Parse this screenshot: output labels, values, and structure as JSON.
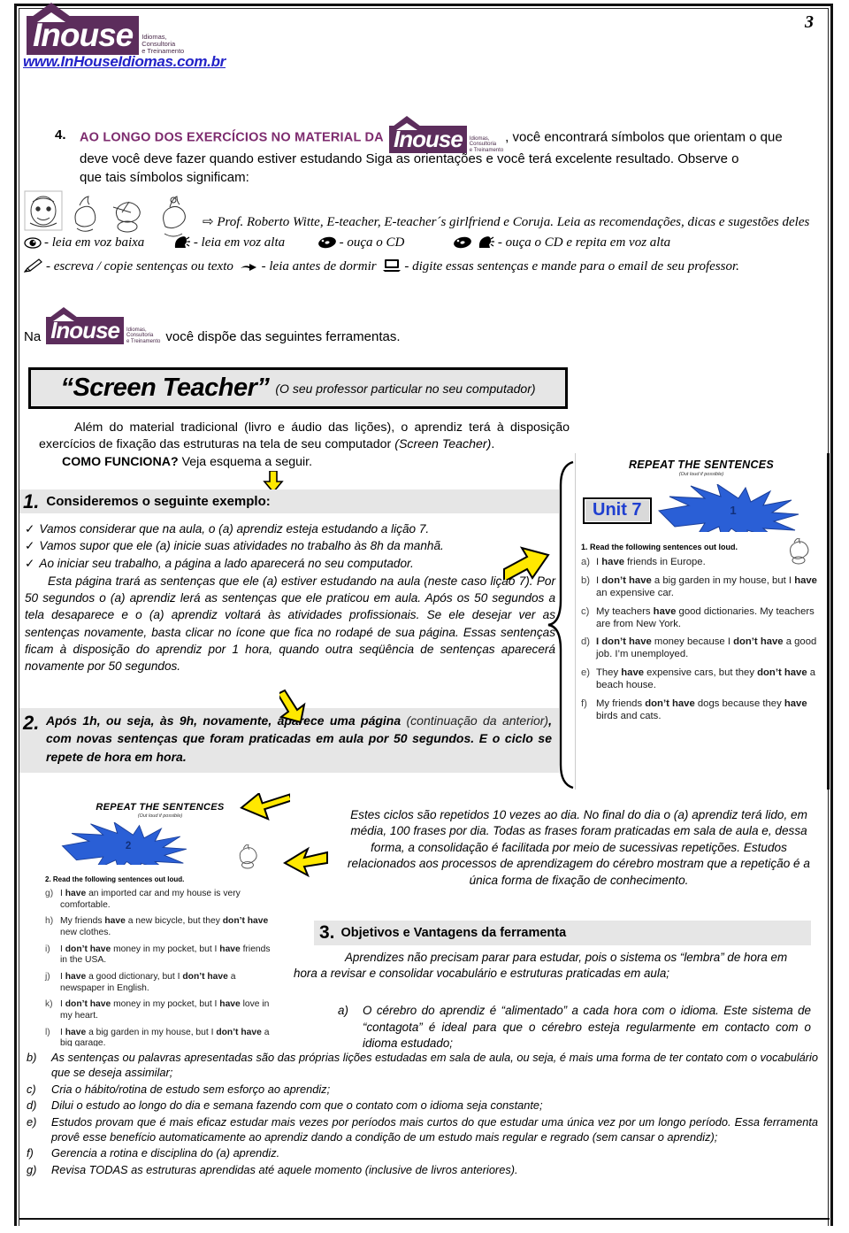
{
  "header": {
    "logo": {
      "wordmark": "nouse",
      "lead_letter": "I",
      "tagline_line1": "Idiomas,",
      "tagline_line2": "Consultoria",
      "tagline_line3": "e Treinamento",
      "brand_color": "#5c2d5c"
    },
    "url": "www.InHouseIdiomas.com.br",
    "page_number": "3"
  },
  "section4": {
    "number": "4.",
    "title": "AO LONGO DOS EXERCÍCIOS NO MATERIAL DA",
    "text_after_logo": ", você encontrará símbolos que orientam o que",
    "line2": "deve você deve fazer quando estiver estudando  Siga as orientações e você terá excelente resultado. Observe o",
    "line3": "que tais símbolos significam:"
  },
  "legend": {
    "characters_line": "Prof. Roberto Witte, E-teacher, E-teacher´s girlfriend e Coruja. Leia  as recomendações, dicas e sugestões deles",
    "arrow_glyph": "⇨",
    "items": [
      {
        "icon": "eye-icon",
        "glyph": "👁",
        "label": "- leia em voz baixa"
      },
      {
        "icon": "speaking-head-icon",
        "glyph": "🗣",
        "label": "- leia em voz alta"
      },
      {
        "icon": "cd-icon",
        "glyph": "💿",
        "label": "- ouça o CD"
      },
      {
        "icon": "cd-and-speaking-head-icon",
        "glyph": "💿🗣",
        "label": "- ouça o CD e repita em voz alta"
      },
      {
        "icon": "pencil-icon",
        "glyph": "✎",
        "label": "- escreva / copie sentenças ou texto"
      },
      {
        "icon": "bed-reading-icon",
        "glyph": "🛏",
        "label": "- leia antes de dormir"
      },
      {
        "icon": "computer-icon",
        "glyph": "🖥",
        "label": "- digite essas sentenças e mande para o email de seu professor."
      }
    ]
  },
  "tools_line": {
    "prefix": "Na",
    "suffix": "você dispõe das seguintes ferramentas."
  },
  "screen_teacher": {
    "title": "“Screen Teacher”",
    "subtitle": "(O seu professor particular no seu computador)",
    "paragraph_indent": "Além do material tradicional (livro e áudio das lições), o aprendiz terá à disposição exercícios de fixação das estruturas na tela de seu computador ",
    "paragraph_italic": "(Screen Teacher)",
    "paragraph_end": ".",
    "how_label": "COMO FUNCIONA?",
    "how_text": " Veja esquema a seguir."
  },
  "block1": {
    "number": "1.",
    "heading": "Consideremos o seguinte exemplo:",
    "bullets": [
      "Vamos considerar que na aula, o (a) aprendiz esteja estudando a lição 7.",
      "Vamos supor que ele (a) inicie suas atividades no trabalho às 8h da manhã.",
      "Ao iniciar seu trabalho, a página a lado aparecerá no seu computador."
    ],
    "paragraph": "Esta página trará as sentenças que ele (a) estiver estudando na aula (neste caso lição 7). Por 50 segundos o (a) aprendiz lerá as sentenças que ele praticou em aula. Após os 50 segundos a tela desaparece e o (a) aprendiz voltará às atividades profissionais. Se ele desejar ver as sentenças novamente, basta clicar no ícone que fica no rodapé de sua página. Essas sentenças ficam à disposição do aprendiz por 1 hora, quando outra seqüência de sentenças aparecerá novamente por 50 segundos."
  },
  "block2": {
    "number": "2.",
    "part1": "Após 1h, ou seja, às 9h, novamente, aparece uma página ",
    "part2_light": "(continuação da anterior)",
    "part3": ", com novas sentenças que foram praticadas em aula por 50 segundos. E o ciclo se repete de hora em hora."
  },
  "screenshot_unit7": {
    "title": "REPEAT THE SENTENCES",
    "subtitle": "(Out loud if possible)",
    "unit_label": "Unit 7",
    "star_number": "1",
    "instruction": "1. Read the following sentences out loud.",
    "sentences": [
      {
        "letter": "a)",
        "html": "I <b>have</b> friends in Europe."
      },
      {
        "letter": "b)",
        "html": "I <b>don’t have</b> a big garden in my house, but I <b>have</b> an expensive car."
      },
      {
        "letter": "c)",
        "html": "My teachers <b>have</b> good dictionaries. My teachers are from New York."
      },
      {
        "letter": "d)",
        "html": "<b>I don’t have</b> money because I <b>don’t have</b> a good job. I’m unemployed."
      },
      {
        "letter": "e)",
        "html": "They <b>have</b> expensive cars, but they <b>don’t have</b> a beach house."
      },
      {
        "letter": "f)",
        "html": "My friends <b>don’t have</b> dogs because they <b>have</b> birds and cats."
      }
    ]
  },
  "screenshot_unit7b": {
    "title": "REPEAT THE SENTENCES",
    "subtitle": "(Out loud if possible)",
    "star_number": "2",
    "instruction": "2. Read the following sentences out loud.",
    "sentences": [
      {
        "letter": "g)",
        "html": "I <b>have</b> an imported car and my house is very comfortable."
      },
      {
        "letter": "h)",
        "html": "My friends <b>have</b> a new bicycle, but they <b>don’t have</b> new clothes."
      },
      {
        "letter": "i)",
        "html": "I <b>don’t have</b> money in my pocket, but I <b>have</b> friends in the USA."
      },
      {
        "letter": "j)",
        "html": "I <b>have</b> a good dictionary, but I <b>don’t have</b> a newspaper in English."
      },
      {
        "letter": "k)",
        "html": "I <b>don’t have</b> money in my pocket, but I <b>have</b> love in my heart."
      },
      {
        "letter": "l)",
        "html": "I <b>have</b> a big garden in my house, but I <b>don’t have</b> a big garage."
      }
    ]
  },
  "cycles_paragraph": "Estes ciclos são repetidos 10 vezes ao dia. No final do dia o (a) aprendiz terá lido, em média, 100 frases por dia. Todas as frases foram praticadas em sala de aula e, dessa forma, a consolidação é facilitada por meio de sucessivas repetições. Estudos relacionados aos processos de aprendizagem do cérebro mostram que a repetição é a única forma de fixação de conhecimento.",
  "section3": {
    "number": "3.",
    "title": "Objetivos e Vantagens da ferramenta",
    "intro": "Aprendizes não precisam parar para estudar, pois o sistema os “lembra” de hora em hora a revisar e consolidar vocabulário e estruturas praticadas em aula;",
    "items": [
      {
        "marker": "a)",
        "text": "O cérebro do aprendiz é “alimentado” a cada hora com o idioma. Este sistema de “contagota” é ideal para que o cérebro esteja regularmente em contacto com o idioma estudado;"
      },
      {
        "marker": "b)",
        "text": "As sentenças ou palavras apresentadas são das próprias lições estudadas em sala de aula, ou seja, é mais uma forma de ter contato com o vocabulário que se deseja assimilar;"
      },
      {
        "marker": "c)",
        "text": "Cria o hábito/rotina de estudo sem esforço ao aprendiz;"
      },
      {
        "marker": "d)",
        "text": "Dilui o estudo ao longo do dia e semana fazendo com que o contato com o idioma seja constante;"
      },
      {
        "marker": "e)",
        "text": "Estudos provam que é mais eficaz estudar mais vezes por períodos mais curtos do que estudar uma única vez por um longo período. Essa ferramenta provê esse benefício automaticamente ao aprendiz dando a condição de um estudo mais regular e regrado (sem cansar o aprendiz);"
      },
      {
        "marker": "f)",
        "text": "Gerencia a rotina e disciplina do (a) aprendiz."
      },
      {
        "marker": "g)",
        "text": "Revisa TODAS as estruturas aprendidas até aquele momento (inclusive de livros anteriores)."
      }
    ]
  },
  "colors": {
    "brand_purple": "#5c2d5c",
    "link_blue": "#2323c8",
    "arrow_yellow": "#ffe800",
    "star_blue": "#2255d6",
    "panel_gray": "#e6e6e6"
  }
}
